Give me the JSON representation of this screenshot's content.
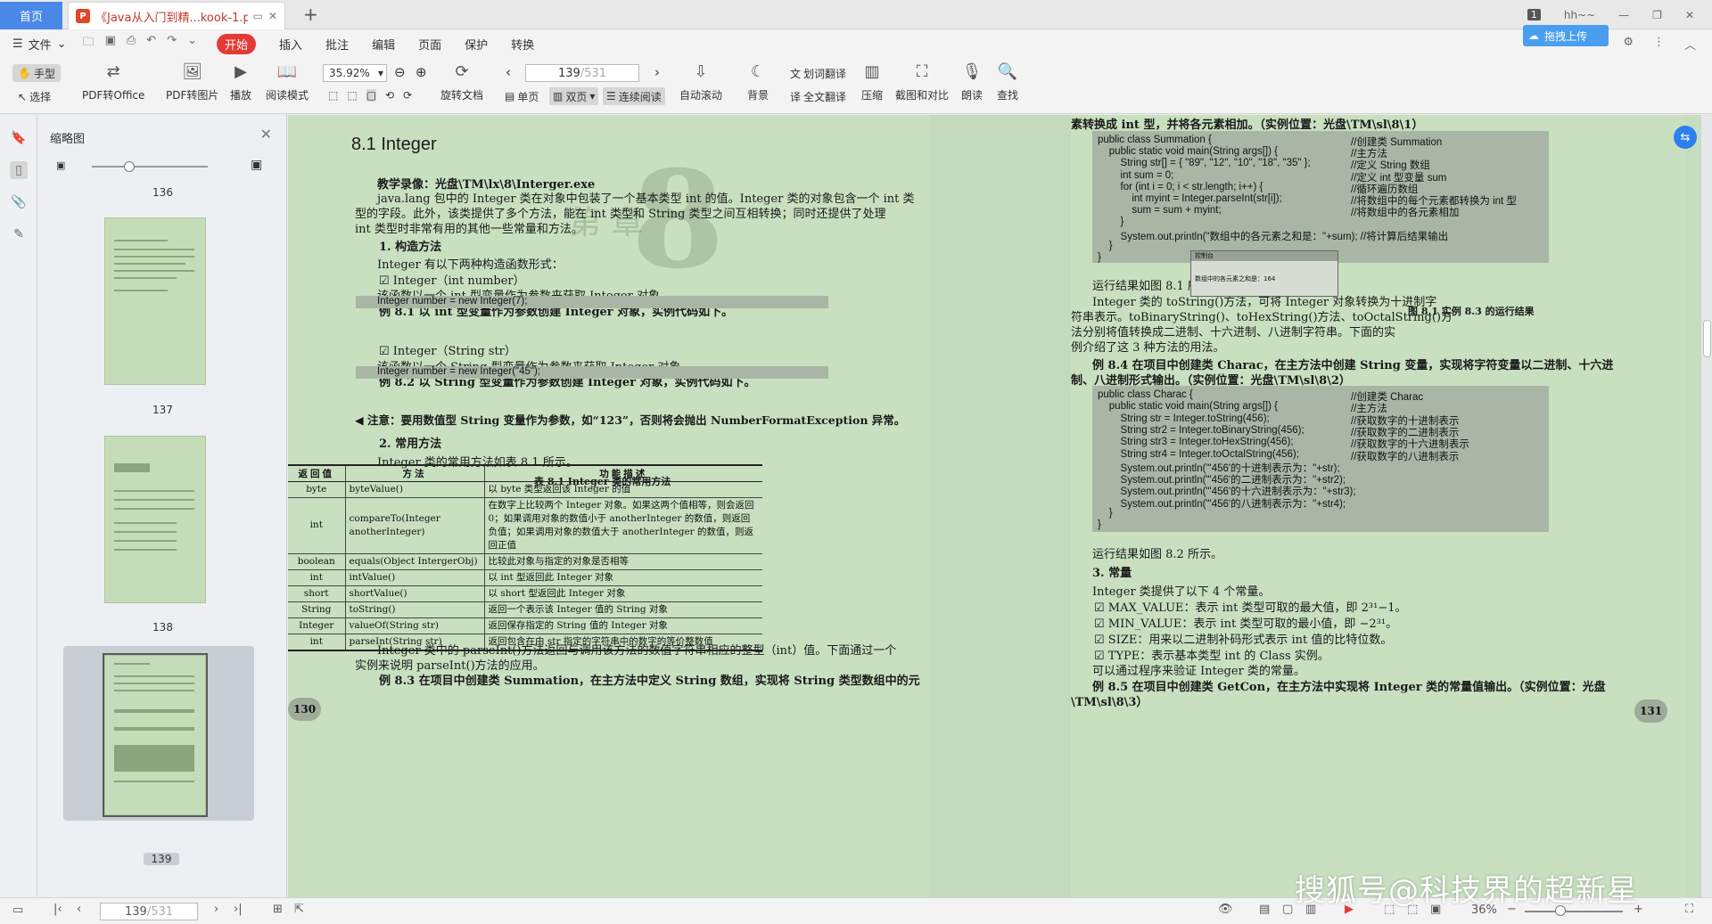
{
  "titlebar": {
    "home_tab": "首页",
    "doc_tab": "《Java从入门到精...kook-1.pdf",
    "badge": "1",
    "user": "hh~~",
    "upload": "拖拽上传"
  },
  "menu": {
    "file": "文件",
    "items": [
      "开始",
      "插入",
      "批注",
      "编辑",
      "页面",
      "保护",
      "转换"
    ],
    "active": "开始"
  },
  "toolbar": {
    "hand": "手型",
    "select": "选择",
    "pdf_to_office": "PDF转Office",
    "pdf_to_image": "PDF转图片",
    "play": "播放",
    "read_mode": "阅读模式",
    "zoom": "35.92%",
    "rotate": "旋转文档",
    "page_current": "139",
    "page_total": "/531",
    "single": "单页",
    "double": "双页",
    "continuous": "连续阅读",
    "auto_scroll": "自动滚动",
    "background": "背景",
    "word_translate": "划词翻译",
    "full_translate": "全文翻译",
    "compress": "压缩",
    "screenshot": "截图和对比",
    "read_aloud": "朗读",
    "find": "查找"
  },
  "thumbs": {
    "title": "缩略图",
    "pages": [
      "136",
      "137",
      "138",
      "139"
    ],
    "selected": "139"
  },
  "left_page": {
    "heading": "8.1   Integer",
    "video": "教学录像：光盘\\TM\\lx\\8\\Interger.exe",
    "p1a": "java.lang 包中的 Integer 类在对象中包装了一个基本类型 int 的值。Integer 类的对象包含一个 int 类",
    "p1b": "型的字段。此外，该类提供了多个方法，能在 int 类型和 String 类型之间互相转换；同时还提供了处理",
    "p1c": "int 类型时非常有用的其他一些常量和方法。",
    "s1": "1. 构造方法",
    "s1t": "Integer 有以下两种构造函数形式：",
    "c1": "Integer（int number）",
    "c1d": "该函数以一个 int 型变量作为参数来获取 Integer 对象。",
    "e1": "例 8.1    以 int 型变量作为参数创建 Integer 对象，实例代码如下。",
    "code1": "Integer number = new Integer(7);",
    "c2": "Integer（String str）",
    "c2d": "该函数以一个 String 型变量作为参数来获取 Integer 对象。",
    "e2": "例 8.2    以 String 型变量作为参数创建 Integer 对象，实例代码如下。",
    "code2": "Integer number = new Integer(\"45\");",
    "note": "注意：要用数值型 String 变量作为参数，如“123”，否则将会抛出 NumberFormatException 异常。",
    "s2": "2. 常用方法",
    "s2t": "Integer 类的常用方法如表 8.1 所示。",
    "table_caption": "表 8.1    Integer 类的常用方法",
    "table_headers": [
      "返回值",
      "方法",
      "功能描述"
    ],
    "table_rows": [
      [
        "byte",
        "byteValue()",
        "以 byte 类型返回该 Integer 的值"
      ],
      [
        "int",
        "compareTo(Integer anotherInteger)",
        "在数字上比较两个 Integer 对象。如果这两个值相等，则会返回 0；如果调用对象的数值小于 anotherInteger 的数值，则返回负值；如果调用对象的数值大于 anotherInteger 的数值，则返回正值"
      ],
      [
        "boolean",
        "equals(Object IntergerObj)",
        "比较此对象与指定的对象是否相等"
      ],
      [
        "int",
        "intValue()",
        "以 int 型返回此 Integer 对象"
      ],
      [
        "short",
        "shortValue()",
        "以 short 型返回此 Integer 对象"
      ],
      [
        "String",
        "toString()",
        "返回一个表示该 Integer 值的 String 对象"
      ],
      [
        "Integer",
        "valueOf(String str)",
        "返回保存指定的 String 值的 Integer 对象"
      ],
      [
        "int",
        "parseInt(String str)",
        "返回包含在由 str 指定的字符串中的数字的等价整数值"
      ]
    ],
    "p2a": "Integer 类中的 parseInt()方法返回与调用该方法的数值字符串相应的整型（int）值。下面通过一个",
    "p2b": "实例来说明 parseInt()方法的应用。",
    "e3": "例 8.3    在项目中创建类 Summation，在主方法中定义 String 数组，实现将 String 类型数组中的元",
    "page_num": "130"
  },
  "right_page": {
    "top": "素转换成 int 型，并将各元素相加。（实例位置：光盘\\TM\\sl\\8\\1）",
    "code1": [
      [
        "public class Summation {",
        "//创建类 Summation"
      ],
      [
        "    public static void main(String args[]) {",
        "//主方法"
      ],
      [
        "        String str[] = { \"89\", \"12\", \"10\", \"18\", \"35\" };",
        "//定义 String 数组"
      ],
      [
        "        int sum = 0;",
        "//定义 int 型变量 sum"
      ],
      [
        "        for (int i = 0; i < str.length; i++) {",
        "//循环遍历数组"
      ],
      [
        "            int myint = Integer.parseInt(str[i]);",
        "//将数组中的每个元素都转换为 int 型"
      ],
      [
        "            sum = sum + myint;",
        "//将数组中的各元素相加"
      ],
      [
        "        }",
        ""
      ],
      [
        "        System.out.println(\"数组中的各元素之和是：\"+sum); //将计算后结果输出",
        ""
      ],
      [
        "    }",
        ""
      ],
      [
        "}",
        ""
      ]
    ],
    "run1": "运行结果如图 8.1 所示。",
    "p1a": "Integer 类的 toString()方法，可将 Integer 对象转换为十进制字",
    "p1b": "符串表示。toBinaryString()、toHexString()方法、toOctalString()方",
    "p1c": "法分别将值转换成二进制、十六进制、八进制字符串。下面的实",
    "p1d": "例介绍了这 3 种方法的用法。",
    "fig_caption": "图 8.1    实例 8.3 的运行结果",
    "fig_title": "控制台",
    "fig_text": "数组中的各元素之和是：164",
    "e4a": "例 8.4    在项目中创建类 Charac，在主方法中创建 String 变量，实现将字符变量以二进制、十六进",
    "e4b": "制、八进制形式输出。（实例位置：光盘\\TM\\sl\\8\\2）",
    "code2": [
      [
        "public class Charac {",
        "//创建类 Charac"
      ],
      [
        "    public static void main(String args[]) {",
        "//主方法"
      ],
      [
        "        String str = Integer.toString(456);",
        "//获取数字的十进制表示"
      ],
      [
        "        String str2 = Integer.toBinaryString(456);",
        "//获取数字的二进制表示"
      ],
      [
        "        String str3 = Integer.toHexString(456);",
        "//获取数字的十六进制表示"
      ],
      [
        "        String str4 = Integer.toOctalString(456);",
        "//获取数字的八进制表示"
      ],
      [
        "        System.out.println(\"'456'的十进制表示为：\"+str);",
        ""
      ],
      [
        "        System.out.println(\"'456'的二进制表示为：\"+str2);",
        ""
      ],
      [
        "        System.out.println(\"'456'的十六进制表示为：\"+str3);",
        ""
      ],
      [
        "        System.out.println(\"'456'的八进制表示为：\"+str4);",
        ""
      ],
      [
        "    }",
        ""
      ],
      [
        "}",
        ""
      ]
    ],
    "run2": "运行结果如图 8.2 所示。",
    "s3": "3. 常量",
    "s3t": "Integer 类提供了以下 4 个常量。",
    "k1": "MAX_VALUE：表示 int 类型可取的最大值，即 2³¹−1。",
    "k2": "MIN_VALUE：表示 int 类型可取的最小值，即 −2³¹。",
    "k3": "SIZE：用来以二进制补码形式表示 int 值的比特位数。",
    "k4": "TYPE：表示基本类型 int 的 Class 实例。",
    "k5": "可以通过程序来验证 Integer 类的常量。",
    "e5a": "例 8.5    在项目中创建类 GetCon，在主方法中实现将 Integer 类的常量值输出。（实例位置：光盘",
    "e5b": "\\TM\\sl\\8\\3）",
    "page_num": "131"
  },
  "statusbar": {
    "page_current": "139",
    "page_total": "/531",
    "zoom": "36%"
  },
  "watermark": "搜狐号@科技界的超新星"
}
